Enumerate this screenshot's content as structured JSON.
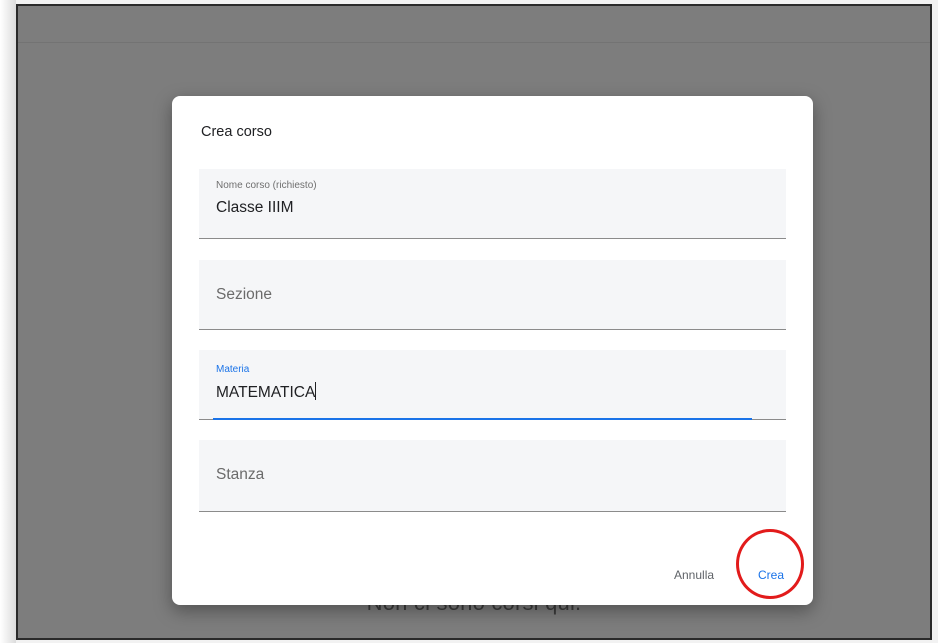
{
  "dialog": {
    "title": "Crea corso",
    "fields": {
      "course_name": {
        "label": "Nome corso (richiesto)",
        "value": "Classe IIIM"
      },
      "section": {
        "placeholder": "Sezione"
      },
      "subject": {
        "label": "Materia",
        "value": "MATEMATICA"
      },
      "room": {
        "placeholder": "Stanza"
      }
    },
    "buttons": {
      "cancel": "Annulla",
      "create": "Crea"
    }
  },
  "background": {
    "empty_message": "Non ci sono corsi qui."
  },
  "colors": {
    "accent": "#1a73e8",
    "highlight": "#e21b1b",
    "overlay": "#7d7d7d"
  }
}
